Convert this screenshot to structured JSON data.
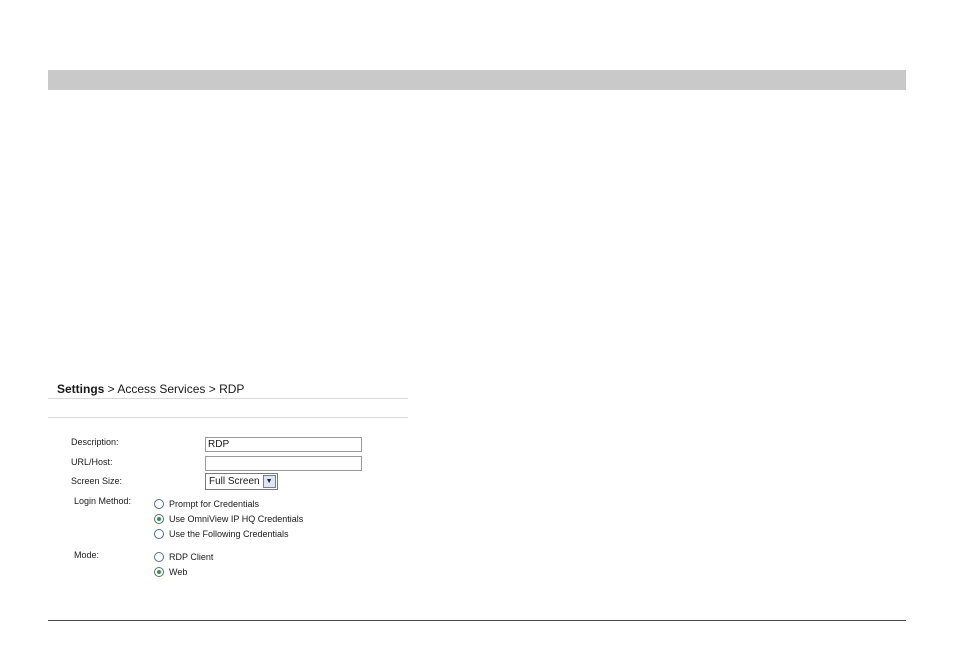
{
  "breadcrumb": {
    "root": "Settings",
    "separator_1": " > ",
    "level_1": "Access Services",
    "separator_2": " > ",
    "level_2": "RDP"
  },
  "form": {
    "description": {
      "label": "Description:",
      "value": "RDP"
    },
    "url_host": {
      "label": "URL/Host:",
      "value": ""
    },
    "screen_size": {
      "label": "Screen Size:",
      "selected": "Full Screen"
    },
    "login_method": {
      "label": "Login Method:",
      "options": [
        {
          "label": "Prompt for Credentials",
          "checked": false
        },
        {
          "label": "Use OmniView IP HQ Credentials",
          "checked": true
        },
        {
          "label": "Use the Following Credentials",
          "checked": false
        }
      ]
    },
    "mode": {
      "label": "Mode:",
      "options": [
        {
          "label": "RDP Client",
          "checked": false
        },
        {
          "label": "Web",
          "checked": true
        }
      ]
    }
  },
  "colors": {
    "header_bar": "#c9c9c9",
    "divider": "#d6dcdc",
    "radio_selected": "#2c9a3a"
  }
}
